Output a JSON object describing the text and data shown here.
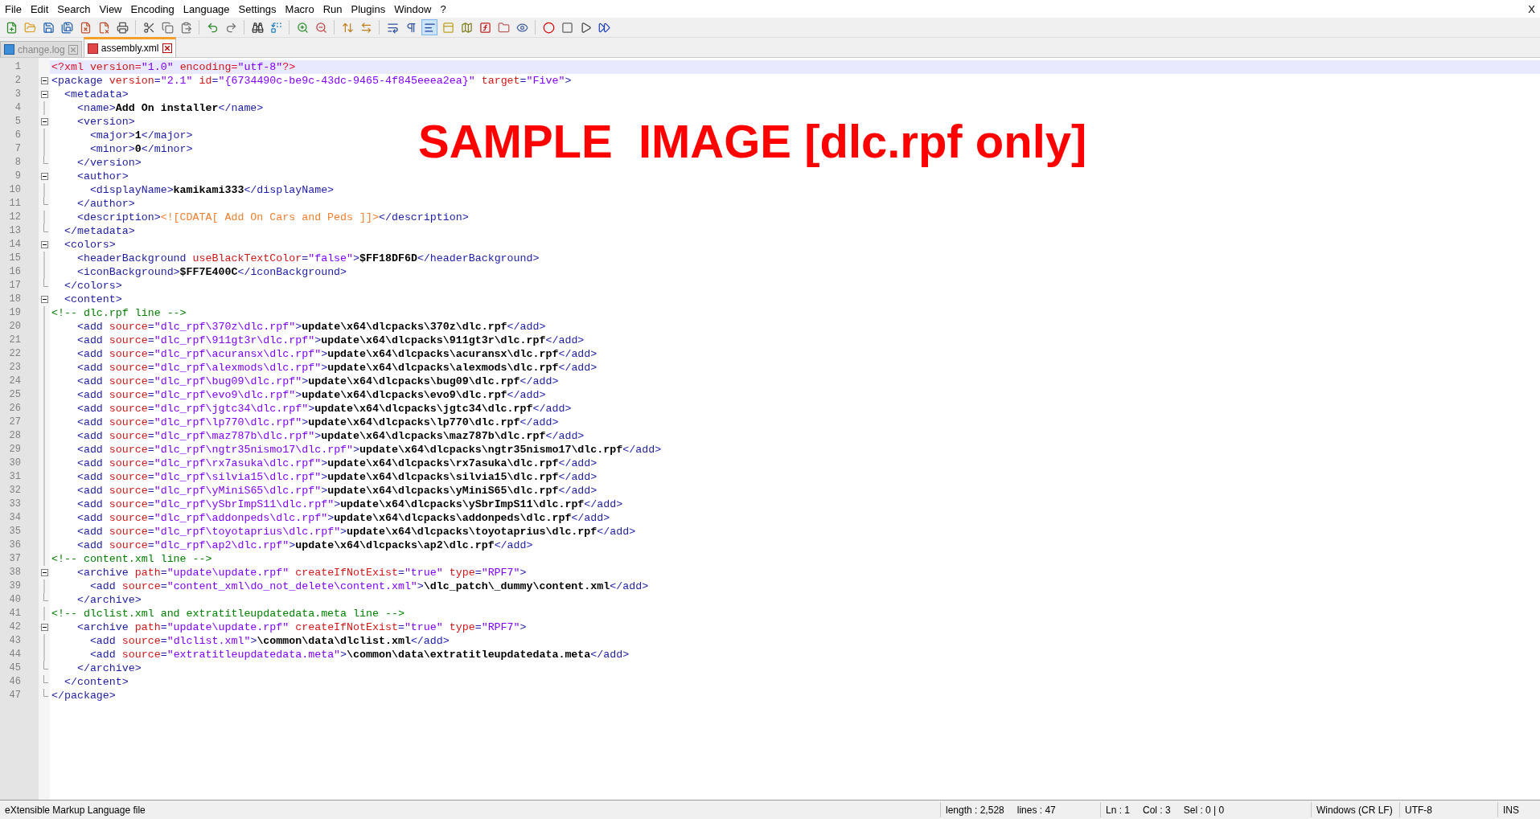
{
  "menu": [
    "File",
    "Edit",
    "Search",
    "View",
    "Encoding",
    "Language",
    "Settings",
    "Macro",
    "Run",
    "Plugins",
    "Window",
    "?"
  ],
  "window_close": "X",
  "toolbar_buttons": [
    {
      "pressed": false
    },
    {
      "pressed": false
    },
    {
      "pressed": false
    },
    {
      "pressed": false
    },
    {
      "pressed": false
    },
    {
      "pressed": false
    },
    {
      "pressed": false
    },
    {
      "pressed": false
    },
    {
      "pressed": false
    },
    {
      "pressed": false
    },
    {
      "pressed": false
    },
    {
      "pressed": false
    },
    {
      "pressed": false
    },
    {
      "pressed": false
    },
    {
      "pressed": false
    },
    {
      "pressed": false
    },
    {
      "pressed": false
    },
    {
      "pressed": false
    },
    {
      "pressed": false
    },
    {
      "pressed": false
    },
    {
      "pressed": true
    },
    {
      "pressed": false
    },
    {
      "pressed": false
    },
    {
      "pressed": false
    },
    {
      "pressed": false
    },
    {
      "pressed": false
    },
    {
      "pressed": false
    },
    {
      "pressed": false
    },
    {
      "pressed": false
    },
    {
      "pressed": false
    }
  ],
  "tabs": [
    {
      "label": "change.log",
      "selected": false
    },
    {
      "label": "assembly.xml",
      "selected": true
    }
  ],
  "overlay_caption": "SAMPLE  IMAGE [dlc.rpf only]",
  "lines": [
    {
      "n": "1",
      "kind": "plain",
      "current": true,
      "tokens": [
        {
          "kind": "pi",
          "text": "<?xml "
        },
        {
          "kind": "attr",
          "text": "version"
        },
        {
          "kind": "pi",
          "text": "="
        },
        {
          "kind": "value",
          "text": "\"1.0\" "
        },
        {
          "kind": "attr",
          "text": "encoding"
        },
        {
          "kind": "pi",
          "text": "="
        },
        {
          "kind": "value",
          "text": "\"utf-8\""
        },
        {
          "kind": "pi",
          "text": "?>"
        }
      ]
    },
    {
      "n": "2",
      "kind": "open",
      "current": false,
      "tokens": [
        {
          "kind": "tag",
          "text": "<package "
        },
        {
          "kind": "attr",
          "text": "version"
        },
        {
          "kind": "tag",
          "text": "="
        },
        {
          "kind": "value",
          "text": "\"2.1\" "
        },
        {
          "kind": "attr",
          "text": "id"
        },
        {
          "kind": "tag",
          "text": "="
        },
        {
          "kind": "value",
          "text": "\"{6734490c-be9c-43dc-9465-4f845eeea2ea}\" "
        },
        {
          "kind": "attr",
          "text": "target"
        },
        {
          "kind": "tag",
          "text": "="
        },
        {
          "kind": "value",
          "text": "\"Five\""
        },
        {
          "kind": "tag",
          "text": ">"
        }
      ]
    },
    {
      "n": "3",
      "kind": "open",
      "current": false,
      "tokens": [
        {
          "kind": "tag",
          "text": "  <metadata>"
        }
      ]
    },
    {
      "n": "4",
      "kind": "mid",
      "current": false,
      "tokens": [
        {
          "kind": "tag",
          "text": "    <name>"
        },
        {
          "kind": "text",
          "text": "Add On installer"
        },
        {
          "kind": "tag",
          "text": "</name>"
        }
      ]
    },
    {
      "n": "5",
      "kind": "open",
      "current": false,
      "tokens": [
        {
          "kind": "tag",
          "text": "    <version>"
        }
      ]
    },
    {
      "n": "6",
      "kind": "mid",
      "current": false,
      "tokens": [
        {
          "kind": "tag",
          "text": "      <major>"
        },
        {
          "kind": "text",
          "text": "1"
        },
        {
          "kind": "tag",
          "text": "</major>"
        }
      ]
    },
    {
      "n": "7",
      "kind": "mid",
      "current": false,
      "tokens": [
        {
          "kind": "tag",
          "text": "      <minor>"
        },
        {
          "kind": "text",
          "text": "0"
        },
        {
          "kind": "tag",
          "text": "</minor>"
        }
      ]
    },
    {
      "n": "8",
      "kind": "end",
      "current": false,
      "tokens": [
        {
          "kind": "tag",
          "text": "    </version>"
        }
      ]
    },
    {
      "n": "9",
      "kind": "open",
      "current": false,
      "tokens": [
        {
          "kind": "tag",
          "text": "    <author>"
        }
      ]
    },
    {
      "n": "10",
      "kind": "mid",
      "current": false,
      "tokens": [
        {
          "kind": "tag",
          "text": "      <displayName>"
        },
        {
          "kind": "text",
          "text": "kamikami333"
        },
        {
          "kind": "tag",
          "text": "</displayName>"
        }
      ]
    },
    {
      "n": "11",
      "kind": "end",
      "current": false,
      "tokens": [
        {
          "kind": "tag",
          "text": "    </author>"
        }
      ]
    },
    {
      "n": "12",
      "kind": "mid",
      "current": false,
      "tokens": [
        {
          "kind": "tag",
          "text": "    <description>"
        },
        {
          "kind": "cdata",
          "text": "<![CDATA[ Add On Cars and Peds ]]>"
        },
        {
          "kind": "tag",
          "text": "</description>"
        }
      ]
    },
    {
      "n": "13",
      "kind": "end",
      "current": false,
      "tokens": [
        {
          "kind": "tag",
          "text": "  </metadata>"
        }
      ]
    },
    {
      "n": "14",
      "kind": "open",
      "current": false,
      "tokens": [
        {
          "kind": "tag",
          "text": "  <colors>"
        }
      ]
    },
    {
      "n": "15",
      "kind": "mid",
      "current": false,
      "tokens": [
        {
          "kind": "tag",
          "text": "    <headerBackground "
        },
        {
          "kind": "attr",
          "text": "useBlackTextColor"
        },
        {
          "kind": "tag",
          "text": "="
        },
        {
          "kind": "value",
          "text": "\"false\""
        },
        {
          "kind": "tag",
          "text": ">"
        },
        {
          "kind": "text",
          "text": "$FF18DF6D"
        },
        {
          "kind": "tag",
          "text": "</headerBackground>"
        }
      ]
    },
    {
      "n": "16",
      "kind": "mid",
      "current": false,
      "tokens": [
        {
          "kind": "tag",
          "text": "    <iconBackground>"
        },
        {
          "kind": "text",
          "text": "$FF7E400C"
        },
        {
          "kind": "tag",
          "text": "</iconBackground>"
        }
      ]
    },
    {
      "n": "17",
      "kind": "end",
      "current": false,
      "tokens": [
        {
          "kind": "tag",
          "text": "  </colors>"
        }
      ]
    },
    {
      "n": "18",
      "kind": "open",
      "current": false,
      "tokens": [
        {
          "kind": "tag",
          "text": "  <content>"
        }
      ]
    },
    {
      "n": "19",
      "kind": "mid",
      "current": false,
      "tokens": [
        {
          "kind": "comment",
          "text": "<!-- dlc.rpf line -->"
        }
      ]
    },
    {
      "n": "20",
      "kind": "mid",
      "current": false,
      "tokens": [
        {
          "kind": "tag",
          "text": "    <add "
        },
        {
          "kind": "attr",
          "text": "source"
        },
        {
          "kind": "tag",
          "text": "="
        },
        {
          "kind": "value",
          "text": "\"dlc_rpf\\370z\\dlc.rpf\""
        },
        {
          "kind": "tag",
          "text": ">"
        },
        {
          "kind": "text",
          "text": "update\\x64\\dlcpacks\\370z\\dlc.rpf"
        },
        {
          "kind": "tag",
          "text": "</add>"
        }
      ]
    },
    {
      "n": "21",
      "kind": "mid",
      "current": false,
      "tokens": [
        {
          "kind": "tag",
          "text": "    <add "
        },
        {
          "kind": "attr",
          "text": "source"
        },
        {
          "kind": "tag",
          "text": "="
        },
        {
          "kind": "value",
          "text": "\"dlc_rpf\\911gt3r\\dlc.rpf\""
        },
        {
          "kind": "tag",
          "text": ">"
        },
        {
          "kind": "text",
          "text": "update\\x64\\dlcpacks\\911gt3r\\dlc.rpf"
        },
        {
          "kind": "tag",
          "text": "</add>"
        }
      ]
    },
    {
      "n": "22",
      "kind": "mid",
      "current": false,
      "tokens": [
        {
          "kind": "tag",
          "text": "    <add "
        },
        {
          "kind": "attr",
          "text": "source"
        },
        {
          "kind": "tag",
          "text": "="
        },
        {
          "kind": "value",
          "text": "\"dlc_rpf\\acuransx\\dlc.rpf\""
        },
        {
          "kind": "tag",
          "text": ">"
        },
        {
          "kind": "text",
          "text": "update\\x64\\dlcpacks\\acuransx\\dlc.rpf"
        },
        {
          "kind": "tag",
          "text": "</add>"
        }
      ]
    },
    {
      "n": "23",
      "kind": "mid",
      "current": false,
      "tokens": [
        {
          "kind": "tag",
          "text": "    <add "
        },
        {
          "kind": "attr",
          "text": "source"
        },
        {
          "kind": "tag",
          "text": "="
        },
        {
          "kind": "value",
          "text": "\"dlc_rpf\\alexmods\\dlc.rpf\""
        },
        {
          "kind": "tag",
          "text": ">"
        },
        {
          "kind": "text",
          "text": "update\\x64\\dlcpacks\\alexmods\\dlc.rpf"
        },
        {
          "kind": "tag",
          "text": "</add>"
        }
      ]
    },
    {
      "n": "24",
      "kind": "mid",
      "current": false,
      "tokens": [
        {
          "kind": "tag",
          "text": "    <add "
        },
        {
          "kind": "attr",
          "text": "source"
        },
        {
          "kind": "tag",
          "text": "="
        },
        {
          "kind": "value",
          "text": "\"dlc_rpf\\bug09\\dlc.rpf\""
        },
        {
          "kind": "tag",
          "text": ">"
        },
        {
          "kind": "text",
          "text": "update\\x64\\dlcpacks\\bug09\\dlc.rpf"
        },
        {
          "kind": "tag",
          "text": "</add>"
        }
      ]
    },
    {
      "n": "25",
      "kind": "mid",
      "current": false,
      "tokens": [
        {
          "kind": "tag",
          "text": "    <add "
        },
        {
          "kind": "attr",
          "text": "source"
        },
        {
          "kind": "tag",
          "text": "="
        },
        {
          "kind": "value",
          "text": "\"dlc_rpf\\evo9\\dlc.rpf\""
        },
        {
          "kind": "tag",
          "text": ">"
        },
        {
          "kind": "text",
          "text": "update\\x64\\dlcpacks\\evo9\\dlc.rpf"
        },
        {
          "kind": "tag",
          "text": "</add>"
        }
      ]
    },
    {
      "n": "26",
      "kind": "mid",
      "current": false,
      "tokens": [
        {
          "kind": "tag",
          "text": "    <add "
        },
        {
          "kind": "attr",
          "text": "source"
        },
        {
          "kind": "tag",
          "text": "="
        },
        {
          "kind": "value",
          "text": "\"dlc_rpf\\jgtc34\\dlc.rpf\""
        },
        {
          "kind": "tag",
          "text": ">"
        },
        {
          "kind": "text",
          "text": "update\\x64\\dlcpacks\\jgtc34\\dlc.rpf"
        },
        {
          "kind": "tag",
          "text": "</add>"
        }
      ]
    },
    {
      "n": "27",
      "kind": "mid",
      "current": false,
      "tokens": [
        {
          "kind": "tag",
          "text": "    <add "
        },
        {
          "kind": "attr",
          "text": "source"
        },
        {
          "kind": "tag",
          "text": "="
        },
        {
          "kind": "value",
          "text": "\"dlc_rpf\\lp770\\dlc.rpf\""
        },
        {
          "kind": "tag",
          "text": ">"
        },
        {
          "kind": "text",
          "text": "update\\x64\\dlcpacks\\lp770\\dlc.rpf"
        },
        {
          "kind": "tag",
          "text": "</add>"
        }
      ]
    },
    {
      "n": "28",
      "kind": "mid",
      "current": false,
      "tokens": [
        {
          "kind": "tag",
          "text": "    <add "
        },
        {
          "kind": "attr",
          "text": "source"
        },
        {
          "kind": "tag",
          "text": "="
        },
        {
          "kind": "value",
          "text": "\"dlc_rpf\\maz787b\\dlc.rpf\""
        },
        {
          "kind": "tag",
          "text": ">"
        },
        {
          "kind": "text",
          "text": "update\\x64\\dlcpacks\\maz787b\\dlc.rpf"
        },
        {
          "kind": "tag",
          "text": "</add>"
        }
      ]
    },
    {
      "n": "29",
      "kind": "mid",
      "current": false,
      "tokens": [
        {
          "kind": "tag",
          "text": "    <add "
        },
        {
          "kind": "attr",
          "text": "source"
        },
        {
          "kind": "tag",
          "text": "="
        },
        {
          "kind": "value",
          "text": "\"dlc_rpf\\ngtr35nismo17\\dlc.rpf\""
        },
        {
          "kind": "tag",
          "text": ">"
        },
        {
          "kind": "text",
          "text": "update\\x64\\dlcpacks\\ngtr35nismo17\\dlc.rpf"
        },
        {
          "kind": "tag",
          "text": "</add>"
        }
      ]
    },
    {
      "n": "30",
      "kind": "mid",
      "current": false,
      "tokens": [
        {
          "kind": "tag",
          "text": "    <add "
        },
        {
          "kind": "attr",
          "text": "source"
        },
        {
          "kind": "tag",
          "text": "="
        },
        {
          "kind": "value",
          "text": "\"dlc_rpf\\rx7asuka\\dlc.rpf\""
        },
        {
          "kind": "tag",
          "text": ">"
        },
        {
          "kind": "text",
          "text": "update\\x64\\dlcpacks\\rx7asuka\\dlc.rpf"
        },
        {
          "kind": "tag",
          "text": "</add>"
        }
      ]
    },
    {
      "n": "31",
      "kind": "mid",
      "current": false,
      "tokens": [
        {
          "kind": "tag",
          "text": "    <add "
        },
        {
          "kind": "attr",
          "text": "source"
        },
        {
          "kind": "tag",
          "text": "="
        },
        {
          "kind": "value",
          "text": "\"dlc_rpf\\silvia15\\dlc.rpf\""
        },
        {
          "kind": "tag",
          "text": ">"
        },
        {
          "kind": "text",
          "text": "update\\x64\\dlcpacks\\silvia15\\dlc.rpf"
        },
        {
          "kind": "tag",
          "text": "</add>"
        }
      ]
    },
    {
      "n": "32",
      "kind": "mid",
      "current": false,
      "tokens": [
        {
          "kind": "tag",
          "text": "    <add "
        },
        {
          "kind": "attr",
          "text": "source"
        },
        {
          "kind": "tag",
          "text": "="
        },
        {
          "kind": "value",
          "text": "\"dlc_rpf\\yMiniS65\\dlc.rpf\""
        },
        {
          "kind": "tag",
          "text": ">"
        },
        {
          "kind": "text",
          "text": "update\\x64\\dlcpacks\\yMiniS65\\dlc.rpf"
        },
        {
          "kind": "tag",
          "text": "</add>"
        }
      ]
    },
    {
      "n": "33",
      "kind": "mid",
      "current": false,
      "tokens": [
        {
          "kind": "tag",
          "text": "    <add "
        },
        {
          "kind": "attr",
          "text": "source"
        },
        {
          "kind": "tag",
          "text": "="
        },
        {
          "kind": "value",
          "text": "\"dlc_rpf\\ySbrImpS11\\dlc.rpf\""
        },
        {
          "kind": "tag",
          "text": ">"
        },
        {
          "kind": "text",
          "text": "update\\x64\\dlcpacks\\ySbrImpS11\\dlc.rpf"
        },
        {
          "kind": "tag",
          "text": "</add>"
        }
      ]
    },
    {
      "n": "34",
      "kind": "mid",
      "current": false,
      "tokens": [
        {
          "kind": "tag",
          "text": "    <add "
        },
        {
          "kind": "attr",
          "text": "source"
        },
        {
          "kind": "tag",
          "text": "="
        },
        {
          "kind": "value",
          "text": "\"dlc_rpf\\addonpeds\\dlc.rpf\""
        },
        {
          "kind": "tag",
          "text": ">"
        },
        {
          "kind": "text",
          "text": "update\\x64\\dlcpacks\\addonpeds\\dlc.rpf"
        },
        {
          "kind": "tag",
          "text": "</add>"
        }
      ]
    },
    {
      "n": "35",
      "kind": "mid",
      "current": false,
      "tokens": [
        {
          "kind": "tag",
          "text": "    <add "
        },
        {
          "kind": "attr",
          "text": "source"
        },
        {
          "kind": "tag",
          "text": "="
        },
        {
          "kind": "value",
          "text": "\"dlc_rpf\\toyotaprius\\dlc.rpf\""
        },
        {
          "kind": "tag",
          "text": ">"
        },
        {
          "kind": "text",
          "text": "update\\x64\\dlcpacks\\toyotaprius\\dlc.rpf"
        },
        {
          "kind": "tag",
          "text": "</add>"
        }
      ]
    },
    {
      "n": "36",
      "kind": "mid",
      "current": false,
      "tokens": [
        {
          "kind": "tag",
          "text": "    <add "
        },
        {
          "kind": "attr",
          "text": "source"
        },
        {
          "kind": "tag",
          "text": "="
        },
        {
          "kind": "value",
          "text": "\"dlc_rpf\\ap2\\dlc.rpf\""
        },
        {
          "kind": "tag",
          "text": ">"
        },
        {
          "kind": "text",
          "text": "update\\x64\\dlcpacks\\ap2\\dlc.rpf"
        },
        {
          "kind": "tag",
          "text": "</add>"
        }
      ]
    },
    {
      "n": "37",
      "kind": "mid",
      "current": false,
      "tokens": [
        {
          "kind": "comment",
          "text": "<!-- content.xml line -->"
        }
      ]
    },
    {
      "n": "38",
      "kind": "open",
      "current": false,
      "tokens": [
        {
          "kind": "tag",
          "text": "    <archive "
        },
        {
          "kind": "attr",
          "text": "path"
        },
        {
          "kind": "tag",
          "text": "="
        },
        {
          "kind": "value",
          "text": "\"update\\update.rpf\" "
        },
        {
          "kind": "attr",
          "text": "createIfNotExist"
        },
        {
          "kind": "tag",
          "text": "="
        },
        {
          "kind": "value",
          "text": "\"true\" "
        },
        {
          "kind": "attr",
          "text": "type"
        },
        {
          "kind": "tag",
          "text": "="
        },
        {
          "kind": "value",
          "text": "\"RPF7\""
        },
        {
          "kind": "tag",
          "text": ">"
        }
      ]
    },
    {
      "n": "39",
      "kind": "mid",
      "current": false,
      "tokens": [
        {
          "kind": "tag",
          "text": "      <add "
        },
        {
          "kind": "attr",
          "text": "source"
        },
        {
          "kind": "tag",
          "text": "="
        },
        {
          "kind": "value",
          "text": "\"content_xml\\do_not_delete\\content.xml\""
        },
        {
          "kind": "tag",
          "text": ">"
        },
        {
          "kind": "text",
          "text": "\\dlc_patch\\_dummy\\content.xml"
        },
        {
          "kind": "tag",
          "text": "</add>"
        }
      ]
    },
    {
      "n": "40",
      "kind": "end",
      "current": false,
      "tokens": [
        {
          "kind": "tag",
          "text": "    </archive>"
        }
      ]
    },
    {
      "n": "41",
      "kind": "mid",
      "current": false,
      "tokens": [
        {
          "kind": "comment",
          "text": "<!-- dlclist.xml and extratitleupdatedata.meta line -->"
        }
      ]
    },
    {
      "n": "42",
      "kind": "open",
      "current": false,
      "tokens": [
        {
          "kind": "tag",
          "text": "    <archive "
        },
        {
          "kind": "attr",
          "text": "path"
        },
        {
          "kind": "tag",
          "text": "="
        },
        {
          "kind": "value",
          "text": "\"update\\update.rpf\" "
        },
        {
          "kind": "attr",
          "text": "createIfNotExist"
        },
        {
          "kind": "tag",
          "text": "="
        },
        {
          "kind": "value",
          "text": "\"true\" "
        },
        {
          "kind": "attr",
          "text": "type"
        },
        {
          "kind": "tag",
          "text": "="
        },
        {
          "kind": "value",
          "text": "\"RPF7\""
        },
        {
          "kind": "tag",
          "text": ">"
        }
      ]
    },
    {
      "n": "43",
      "kind": "mid",
      "current": false,
      "tokens": [
        {
          "kind": "tag",
          "text": "      <add "
        },
        {
          "kind": "attr",
          "text": "source"
        },
        {
          "kind": "tag",
          "text": "="
        },
        {
          "kind": "value",
          "text": "\"dlclist.xml\""
        },
        {
          "kind": "tag",
          "text": ">"
        },
        {
          "kind": "text",
          "text": "\\common\\data\\dlclist.xml"
        },
        {
          "kind": "tag",
          "text": "</add>"
        }
      ]
    },
    {
      "n": "44",
      "kind": "mid",
      "current": false,
      "tokens": [
        {
          "kind": "tag",
          "text": "      <add "
        },
        {
          "kind": "attr",
          "text": "source"
        },
        {
          "kind": "tag",
          "text": "="
        },
        {
          "kind": "value",
          "text": "\"extratitleupdatedata.meta\""
        },
        {
          "kind": "tag",
          "text": ">"
        },
        {
          "kind": "text",
          "text": "\\common\\data\\extratitleupdatedata.meta"
        },
        {
          "kind": "tag",
          "text": "</add>"
        }
      ]
    },
    {
      "n": "45",
      "kind": "end",
      "current": false,
      "tokens": [
        {
          "kind": "tag",
          "text": "    </archive>"
        }
      ]
    },
    {
      "n": "46",
      "kind": "end",
      "current": false,
      "tokens": [
        {
          "kind": "tag",
          "text": "  </content>"
        }
      ]
    },
    {
      "n": "47",
      "kind": "end",
      "current": false,
      "tokens": [
        {
          "kind": "tag",
          "text": "</package>"
        }
      ]
    }
  ],
  "status_bar": {
    "file_type": "eXtensible Markup Language file",
    "length": "length : 2,528",
    "lines": "lines : 47",
    "ln": "Ln : 1",
    "col": "Col : 3",
    "sel": "Sel : 0 | 0",
    "eol": "Windows (CR LF)",
    "encoding": "UTF-8",
    "mode": "INS"
  }
}
